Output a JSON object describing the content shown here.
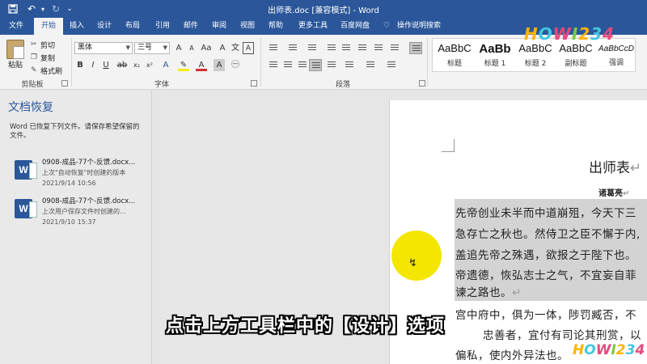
{
  "window": {
    "title": "出师表.doc [兼容模式] - Word"
  },
  "quick_access": {
    "save_icon": "save-icon",
    "undo_icon": "undo-icon",
    "redo_icon": "redo-icon",
    "customize_icon": "customize-icon"
  },
  "tabs": [
    "文件",
    "开始",
    "插入",
    "设计",
    "布局",
    "引用",
    "邮件",
    "审阅",
    "视图",
    "帮助",
    "更多工具",
    "百度网盘"
  ],
  "active_tab": "开始",
  "tell_me": "操作说明搜索",
  "brand_logo": "HOWI234",
  "ribbon": {
    "clipboard": {
      "paste": "粘贴",
      "cut": "剪切",
      "copy": "复制",
      "format_painter": "格式刷",
      "label": "剪贴板"
    },
    "font": {
      "font_name": "黑体",
      "font_size": "三号",
      "label": "字体"
    },
    "paragraph": {
      "label": "段落"
    },
    "styles": [
      {
        "sample": "AaBbC",
        "name": "标题"
      },
      {
        "sample": "AaBb",
        "name": "标题 1"
      },
      {
        "sample": "AaBbC",
        "name": "标题 2"
      },
      {
        "sample": "AaBbC",
        "name": "副标题"
      },
      {
        "sample": "AaBbCcD",
        "name": "强调"
      }
    ]
  },
  "recovery": {
    "title": "文档恢复",
    "description": "Word 已恢复下列文件。请保存希望保留的文件。",
    "files": [
      {
        "name": "0908-成品-77个-反馈.docx...",
        "note": "上次\"自动恢复\"时创建的版本",
        "date": "2021/9/14 10:56"
      },
      {
        "name": "0908-成品-77个-反馈.docx...",
        "note": "上次用户保存文件时创建的...",
        "date": "2021/9/10 15:37"
      }
    ]
  },
  "document": {
    "heading": "出师表",
    "author": "诸葛亮",
    "lines": [
      "先帝创业未半而中道崩殂，今天下三",
      "急存亡之秋也。然侍卫之臣不懈于内,",
      "盖追先帝之殊遇，欲报之于陛下也。",
      "帝遗德，恢弘志士之气，不宜妄自菲",
      "谏之路也。",
      "宫中府中，俱为一体，陟罚臧否，不",
      "忠善者，宜付有司论其刑赏，以",
      "偏私，使内外异法也。"
    ],
    "paragraph_mark": "↵"
  },
  "caption": "点击上方工具栏中的【设计】选项",
  "colors": {
    "accent": "#2b579a",
    "highlight": "#f4e600"
  }
}
